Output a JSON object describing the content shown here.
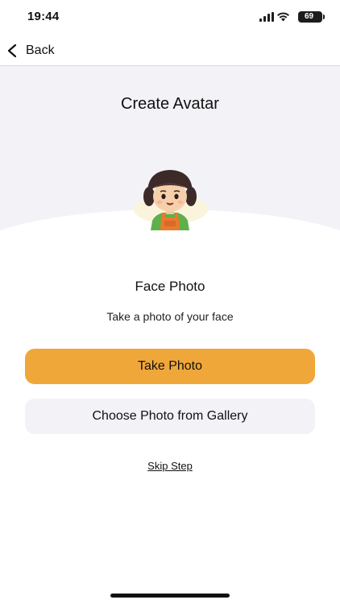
{
  "status_bar": {
    "time": "19:44",
    "battery": "69"
  },
  "nav": {
    "back_label": "Back"
  },
  "header": {
    "title": "Create Avatar"
  },
  "content": {
    "section_title": "Face Photo",
    "section_subtitle": "Take a photo of your face",
    "primary_button": "Take Photo",
    "secondary_button": "Choose Photo from Gallery",
    "skip_link": "Skip Step"
  },
  "colors": {
    "accent": "#f0a73a",
    "header_bg": "#f2f2f7",
    "secondary_button_bg": "#f2f2f7"
  },
  "icons": {
    "back": "chevron-left-icon",
    "signal": "cellular-signal-icon",
    "wifi": "wifi-icon",
    "battery": "battery-icon",
    "avatar": "avatar-illustration"
  }
}
